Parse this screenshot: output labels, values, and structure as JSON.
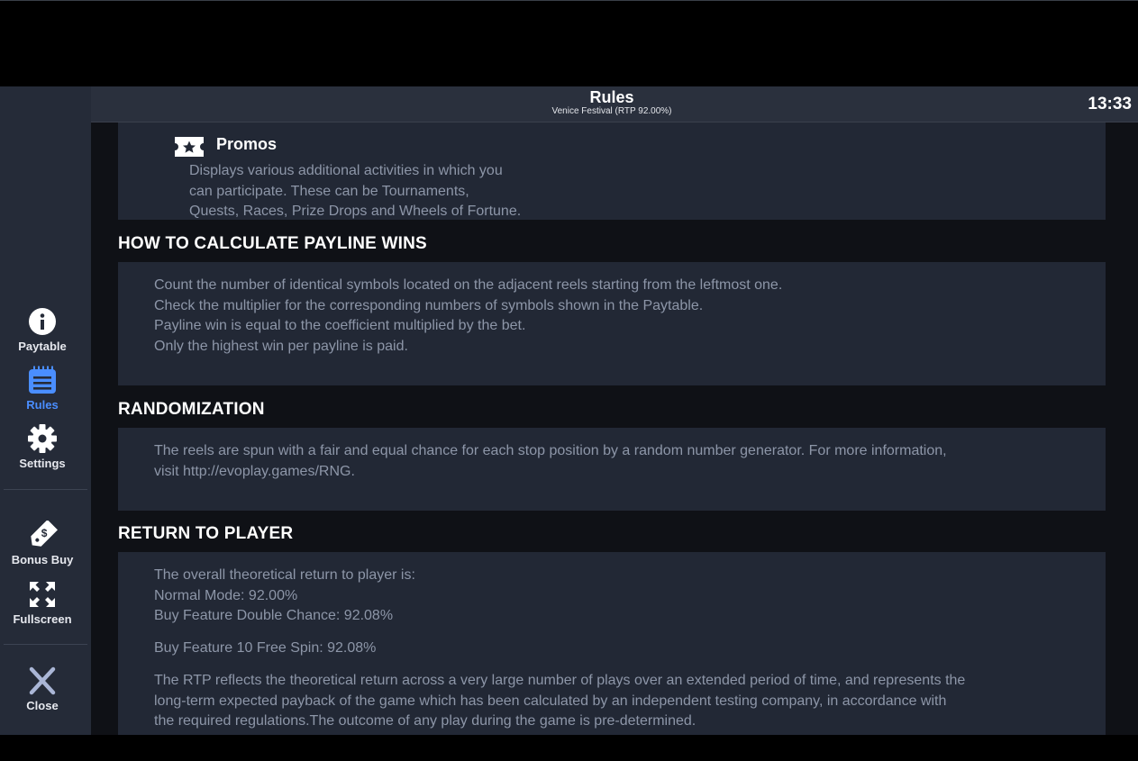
{
  "header": {
    "title": "Rules",
    "subtitle": "Venice Festival (RTP 92.00%)",
    "clock": "13:33"
  },
  "sidebar": {
    "paytable": "Paytable",
    "rules": "Rules",
    "settings": "Settings",
    "bonus_buy": "Bonus Buy",
    "fullscreen": "Fullscreen",
    "close": "Close"
  },
  "promos": {
    "title": "Promos",
    "lines": [
      "Displays various additional activities in which you",
      "can participate. These can be Tournaments,",
      "Quests, Races, Prize Drops and Wheels of Fortune."
    ]
  },
  "payline": {
    "title": "HOW TO CALCULATE PAYLINE WINS",
    "lines": [
      "Count the number of identical symbols located on the adjacent reels starting from the leftmost one.",
      "Check the multiplier for the corresponding numbers of symbols shown in the Paytable.",
      "Payline win is equal to the coefficient multiplied by the bet.",
      "Only the highest win per payline is paid."
    ]
  },
  "randomization": {
    "title": "RANDOMIZATION",
    "lines": [
      "The reels are spun with a fair and equal chance for each stop position by a random number generator. For more information,",
      "visit http://evoplay.games/RNG."
    ]
  },
  "rtp": {
    "title": "RETURN TO PLAYER",
    "lines": [
      "The overall theoretical return to player is:",
      "Normal Mode: 92.00%",
      "Buy Feature Double Chance: 92.08%"
    ],
    "free_spin": "Buy Feature 10 Free Spin: 92.08%",
    "desc_lines": [
      "The RTP reflects the theoretical return across a very large number of plays over an extended period of time, and represents the",
      "long-term expected payback of the game which has been calculated by an independent testing company, in accordance with",
      "the required regulations.The outcome of any play during the game is pre-determined."
    ]
  },
  "colors": {
    "accent": "#4a8eff",
    "panel": "#222835",
    "sidebar": "#252b38",
    "text_muted": "#8d96a8"
  }
}
